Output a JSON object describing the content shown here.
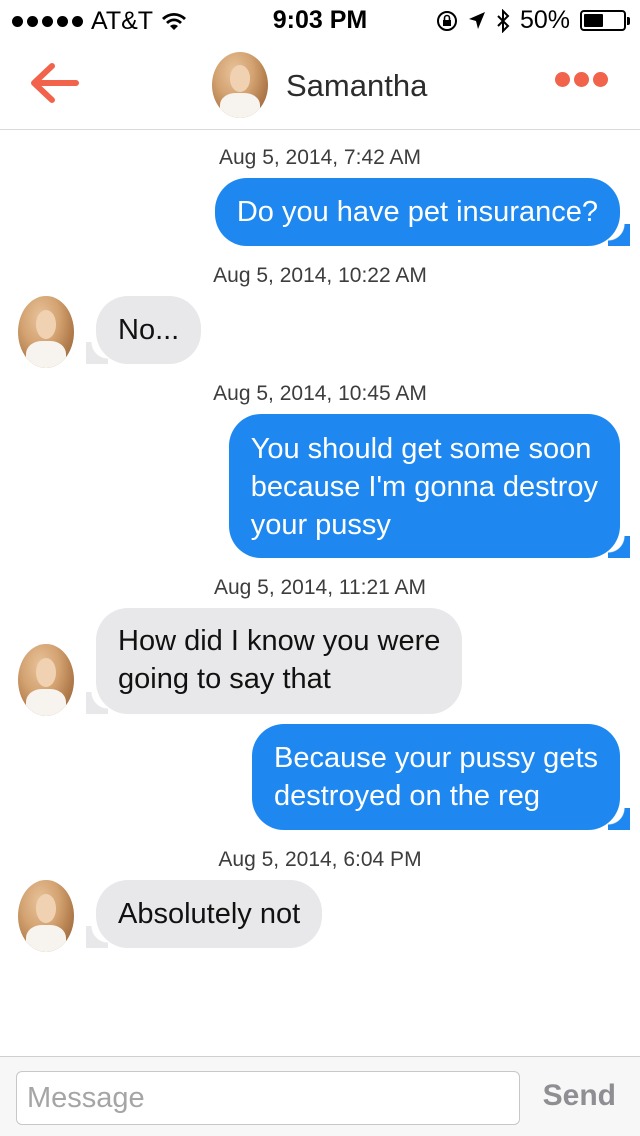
{
  "status_bar": {
    "carrier": "AT&T",
    "time": "9:03 PM",
    "battery_text": "50%",
    "battery_level": 0.5,
    "icons": [
      "signal-dots-icon",
      "wifi-icon",
      "rotation-lock-icon",
      "location-icon",
      "bluetooth-icon",
      "battery-icon"
    ]
  },
  "nav": {
    "title": "Samantha",
    "back_icon": "back-arrow-icon",
    "more_icon": "more-dots-icon",
    "accent_color": "#f1634a"
  },
  "messages": [
    {
      "timestamp": "Aug 5, 2014, 7:42 AM",
      "direction": "out",
      "lines": [
        "Do you have pet insurance?"
      ]
    },
    {
      "timestamp": "Aug 5, 2014, 10:22 AM",
      "direction": "in",
      "lines": [
        "No..."
      ]
    },
    {
      "timestamp": "Aug 5, 2014, 10:45 AM",
      "direction": "out",
      "lines": [
        "You should get some soon",
        "because I'm gonna destroy",
        "your pussy"
      ]
    },
    {
      "timestamp": "Aug 5, 2014, 11:21 AM",
      "direction": "in",
      "lines": [
        "How did I know you were",
        "going to say that"
      ]
    },
    {
      "timestamp": "",
      "direction": "out",
      "lines": [
        "Because your pussy gets",
        "destroyed on the reg"
      ]
    },
    {
      "timestamp": "Aug 5, 2014, 6:04 PM",
      "direction": "in",
      "lines": [
        "Absolutely not"
      ]
    }
  ],
  "colors": {
    "outgoing_bubble": "#1e88f0",
    "incoming_bubble": "#e8e8ea"
  },
  "input": {
    "placeholder": "Message",
    "value": "",
    "send_label": "Send"
  }
}
